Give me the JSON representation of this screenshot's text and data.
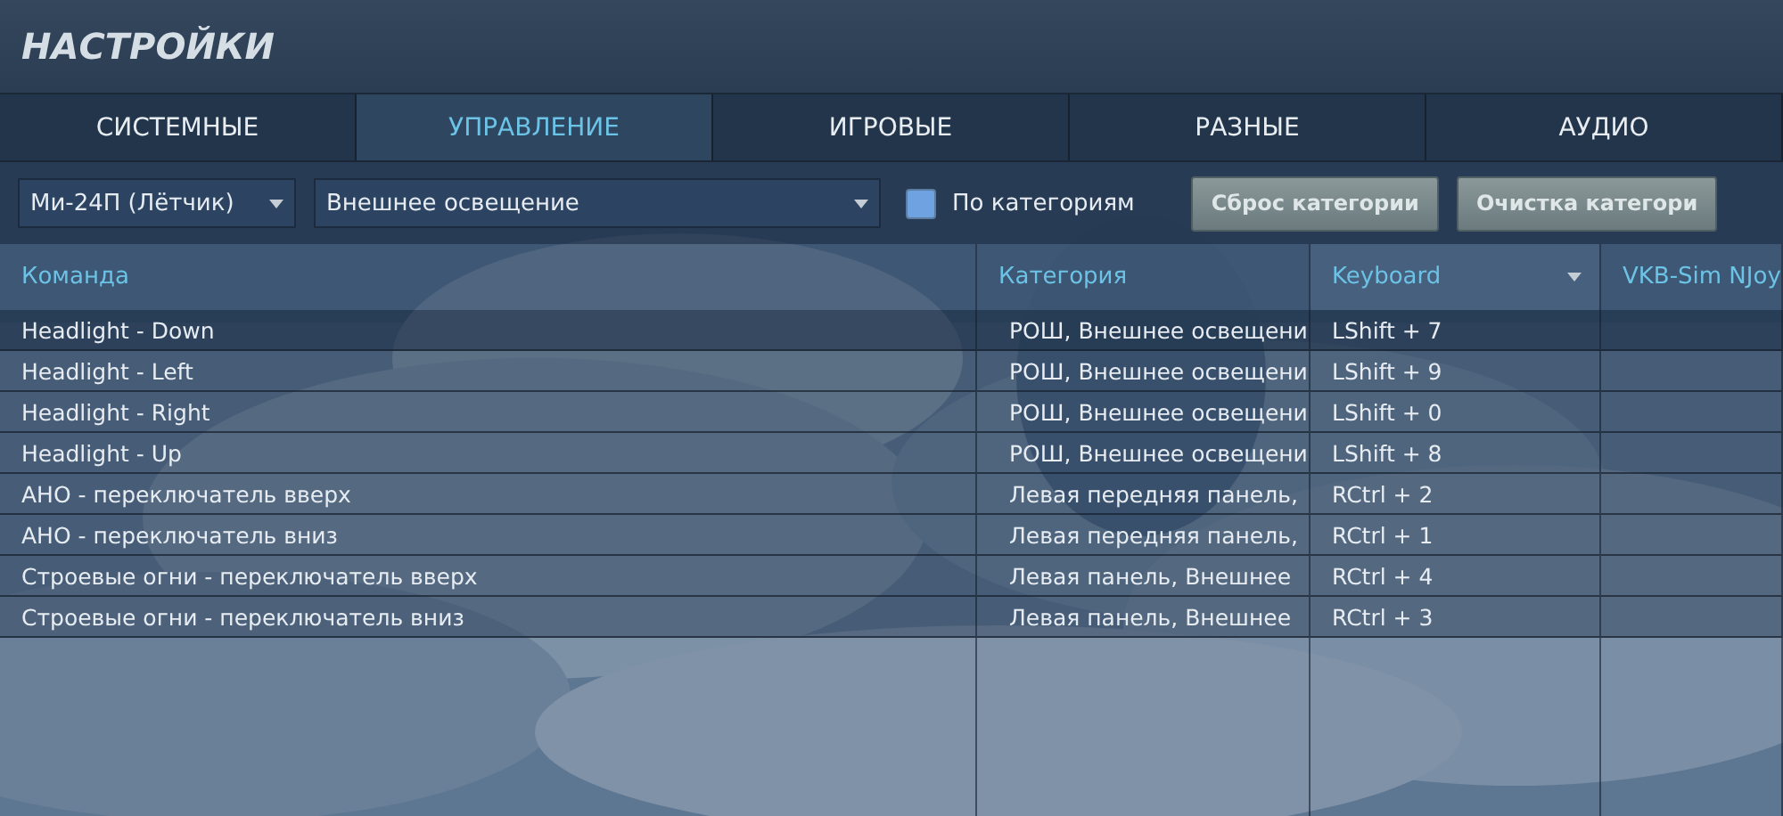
{
  "window": {
    "title": "НАСТРОЙКИ"
  },
  "tabs": [
    {
      "label": "СИСТЕМНЫЕ",
      "selected": false
    },
    {
      "label": "УПРАВЛЕНИЕ",
      "selected": true
    },
    {
      "label": "ИГРОВЫЕ",
      "selected": false
    },
    {
      "label": "РАЗНЫЕ",
      "selected": false
    },
    {
      "label": "АУДИО",
      "selected": false
    }
  ],
  "toolbar": {
    "aircraft_dropdown": "Ми-24П (Лётчик)",
    "category_dropdown": "Внешнее освещение",
    "by_category": {
      "label": "По категориям",
      "checked": true
    },
    "buttons": [
      "Сброс категории",
      "Очистка категори"
    ]
  },
  "table": {
    "columns": [
      {
        "label": "Команда",
        "dropdown": false
      },
      {
        "label": "Категория",
        "dropdown": false
      },
      {
        "label": "Keyboard",
        "dropdown": true
      },
      {
        "label": "VKB-Sim NJoy",
        "dropdown": false
      }
    ],
    "rows": [
      {
        "command": "Headlight - Down",
        "category": "РОШ, Внешнее освещени",
        "keyboard": "LShift + 7",
        "selected": true
      },
      {
        "command": "Headlight - Left",
        "category": "РОШ, Внешнее освещени",
        "keyboard": "LShift + 9",
        "selected": false
      },
      {
        "command": "Headlight - Right",
        "category": "РОШ, Внешнее освещени",
        "keyboard": "LShift + 0",
        "selected": false
      },
      {
        "command": "Headlight - Up",
        "category": "РОШ, Внешнее освещени",
        "keyboard": "LShift + 8",
        "selected": false
      },
      {
        "command": "АНО - переключатель вверх",
        "category": "Левая передняя панель,",
        "keyboard": "RCtrl + 2",
        "selected": false
      },
      {
        "command": "АНО - переключатель вниз",
        "category": "Левая передняя панель,",
        "keyboard": "RCtrl + 1",
        "selected": false
      },
      {
        "command": "Строевые огни - переключатель вверх",
        "category": "Левая панель, Внешнее",
        "keyboard": "RCtrl + 4",
        "selected": false
      },
      {
        "command": "Строевые огни - переключатель вниз",
        "category": "Левая панель, Внешнее",
        "keyboard": "RCtrl + 3",
        "selected": false
      }
    ]
  }
}
